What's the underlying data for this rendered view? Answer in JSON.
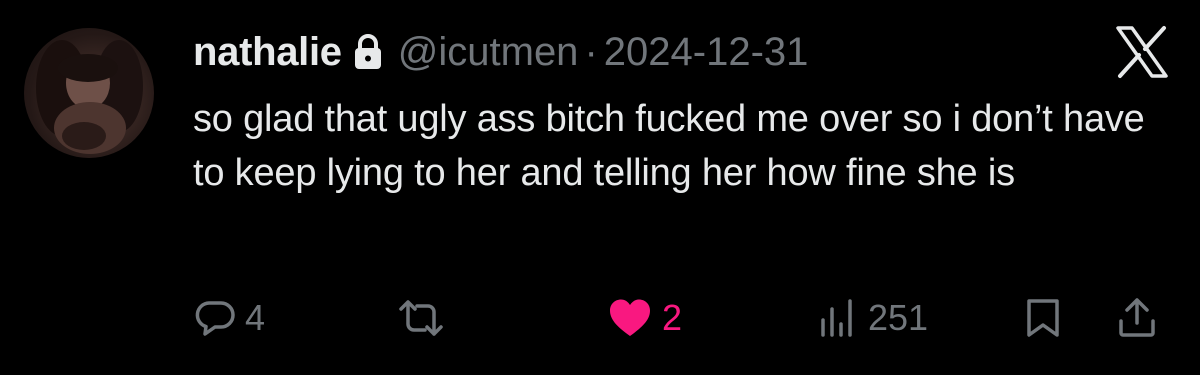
{
  "tweet": {
    "display_name": "nathalie",
    "handle": "@icutmen",
    "separator": "·",
    "date": "2024-12-31",
    "text": "so glad that ugly ass bitch fucked me over so i don’t have to keep lying to her and telling her how fine she is",
    "protected": true
  },
  "actions": {
    "replies": "4",
    "likes": "2",
    "views": "251"
  },
  "icons": {
    "lock": "lock-icon",
    "logo": "x-logo-icon",
    "reply": "reply-icon",
    "retweet": "retweet-icon",
    "like": "heart-icon",
    "views": "views-icon",
    "bookmark": "bookmark-icon",
    "share": "share-icon"
  },
  "colors": {
    "background": "#000000",
    "text": "#e7e9ea",
    "secondary": "#71767b",
    "like": "#f91880"
  }
}
